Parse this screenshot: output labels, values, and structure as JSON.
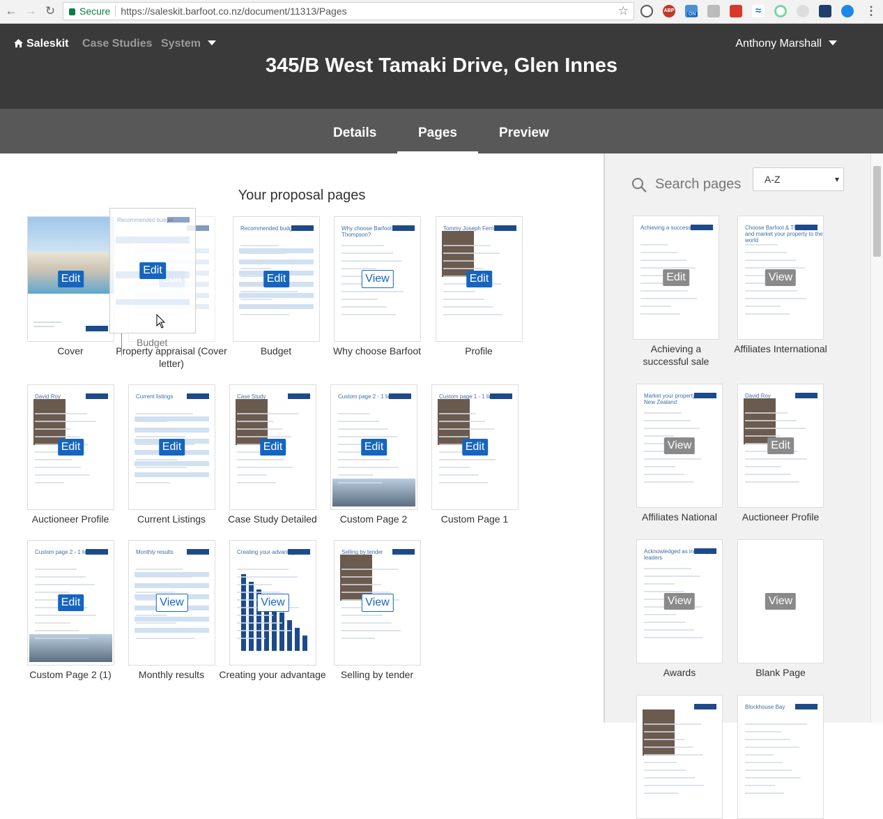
{
  "browser": {
    "secure_label": "Secure",
    "url": "https://saleskit.barfoot.co.nz/document/11313/Pages",
    "ext_badge": "ON",
    "ext_abp": "ABP"
  },
  "nav": {
    "brand": "Saleskit",
    "items": [
      "Case Studies",
      "System"
    ],
    "user": "Anthony Marshall"
  },
  "document_title": "345/B West Tamaki Drive, Glen Innes",
  "tabs": [
    "Details",
    "Pages",
    "Preview"
  ],
  "active_tab": "Pages",
  "proposal": {
    "heading": "Your proposal pages",
    "drag_label": "Budget",
    "pages": [
      {
        "title": "Cover",
        "action": "Edit",
        "header": ""
      },
      {
        "title": "Property appraisal (Cover letter)",
        "action": "Edit",
        "header": ""
      },
      {
        "title": "Budget",
        "action": "Edit",
        "header": "Recommended budget"
      },
      {
        "title": "Why choose Barfoot",
        "action": "View",
        "header": "Why choose Barfoot & Thompson?"
      },
      {
        "title": "Profile",
        "action": "Edit",
        "header": "Tommy Joseph Fernandes"
      },
      {
        "title": "Auctioneer Profile",
        "action": "Edit",
        "header": "David Roy"
      },
      {
        "title": "Current Listings",
        "action": "Edit",
        "header": "Current listings"
      },
      {
        "title": "Case Study Detailed",
        "action": "Edit",
        "header": "Case Study"
      },
      {
        "title": "Custom Page 2",
        "action": "Edit",
        "header": "Custom page 2 - 1 line title"
      },
      {
        "title": "Custom Page 1",
        "action": "Edit",
        "header": "Custom page 1 - 1 line title"
      },
      {
        "title": "Custom Page 2 (1)",
        "action": "Edit",
        "header": "Custom page 2 - 1 line title"
      },
      {
        "title": "Monthly results",
        "action": "View",
        "header": "Monthly results"
      },
      {
        "title": "Creating your advantage",
        "action": "View",
        "header": "Creating your advantage"
      },
      {
        "title": "Selling by tender",
        "action": "View",
        "header": "Selling by tender"
      }
    ]
  },
  "library": {
    "search_placeholder": "Search pages",
    "sort": "A-Z",
    "pages": [
      {
        "title": "Achieving a successful sale",
        "action": "Edit",
        "header": "Achieving a successful sale"
      },
      {
        "title": "Affiliates International",
        "action": "View",
        "header": "Choose Barfoot & Thompson and market your property to the world"
      },
      {
        "title": "Affiliates National",
        "action": "View",
        "header": "Market your property across New Zealand"
      },
      {
        "title": "Auctioneer Profile",
        "action": "Edit",
        "header": "David Roy"
      },
      {
        "title": "Awards",
        "action": "View",
        "header": "Acknowledged as industry leaders"
      },
      {
        "title": "Blank Page",
        "action": "View",
        "header": ""
      },
      {
        "title": "",
        "action": "",
        "header": ""
      },
      {
        "title": "",
        "action": "",
        "header": "Blockhouse Bay"
      }
    ]
  }
}
